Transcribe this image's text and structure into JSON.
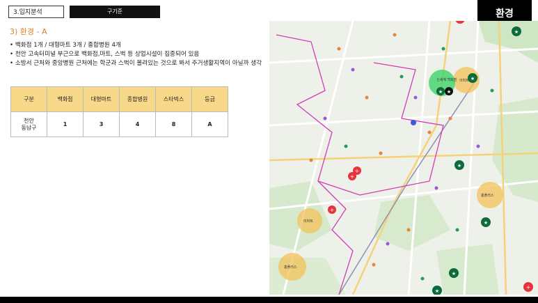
{
  "header": {
    "section_tag": "3.입지분석",
    "subtitle": "구기준",
    "env_title": "환경",
    "env_grade": "A"
  },
  "page_title": "3) 환경 - A",
  "bullets": [
    "백화점 1개 / 대형마트 3개 / 종합병원 4개",
    "천안 고속터미널 부근으로 백화점,마트, 스벅 등 상업시설이 집중되어 있음",
    "소방서 근처와 중앙병원 근처에는 학군과 스벅이 몰려있는 것으로 봐서 주거생활지역이 아닐까 생각"
  ],
  "table": {
    "headers": [
      "구분",
      "백화점",
      "대형마트",
      "종합병원",
      "스타벅스",
      "등급"
    ],
    "row": [
      "천안\n동남구",
      "1",
      "3",
      "4",
      "8",
      "A"
    ]
  },
  "map": {
    "labels": {
      "dept": "신세계\n백화점",
      "emart1": "이마트",
      "emart2": "이마트",
      "homeplus1": "홈플러스",
      "homeplus2": "홈플러스"
    },
    "colors": {
      "mart_circle": "#f3c15a",
      "dept_circle": "#3fd46a",
      "starbucks": "#0b6b3a",
      "hospital": "#e8323c",
      "boundary": "#d43ab8"
    }
  }
}
